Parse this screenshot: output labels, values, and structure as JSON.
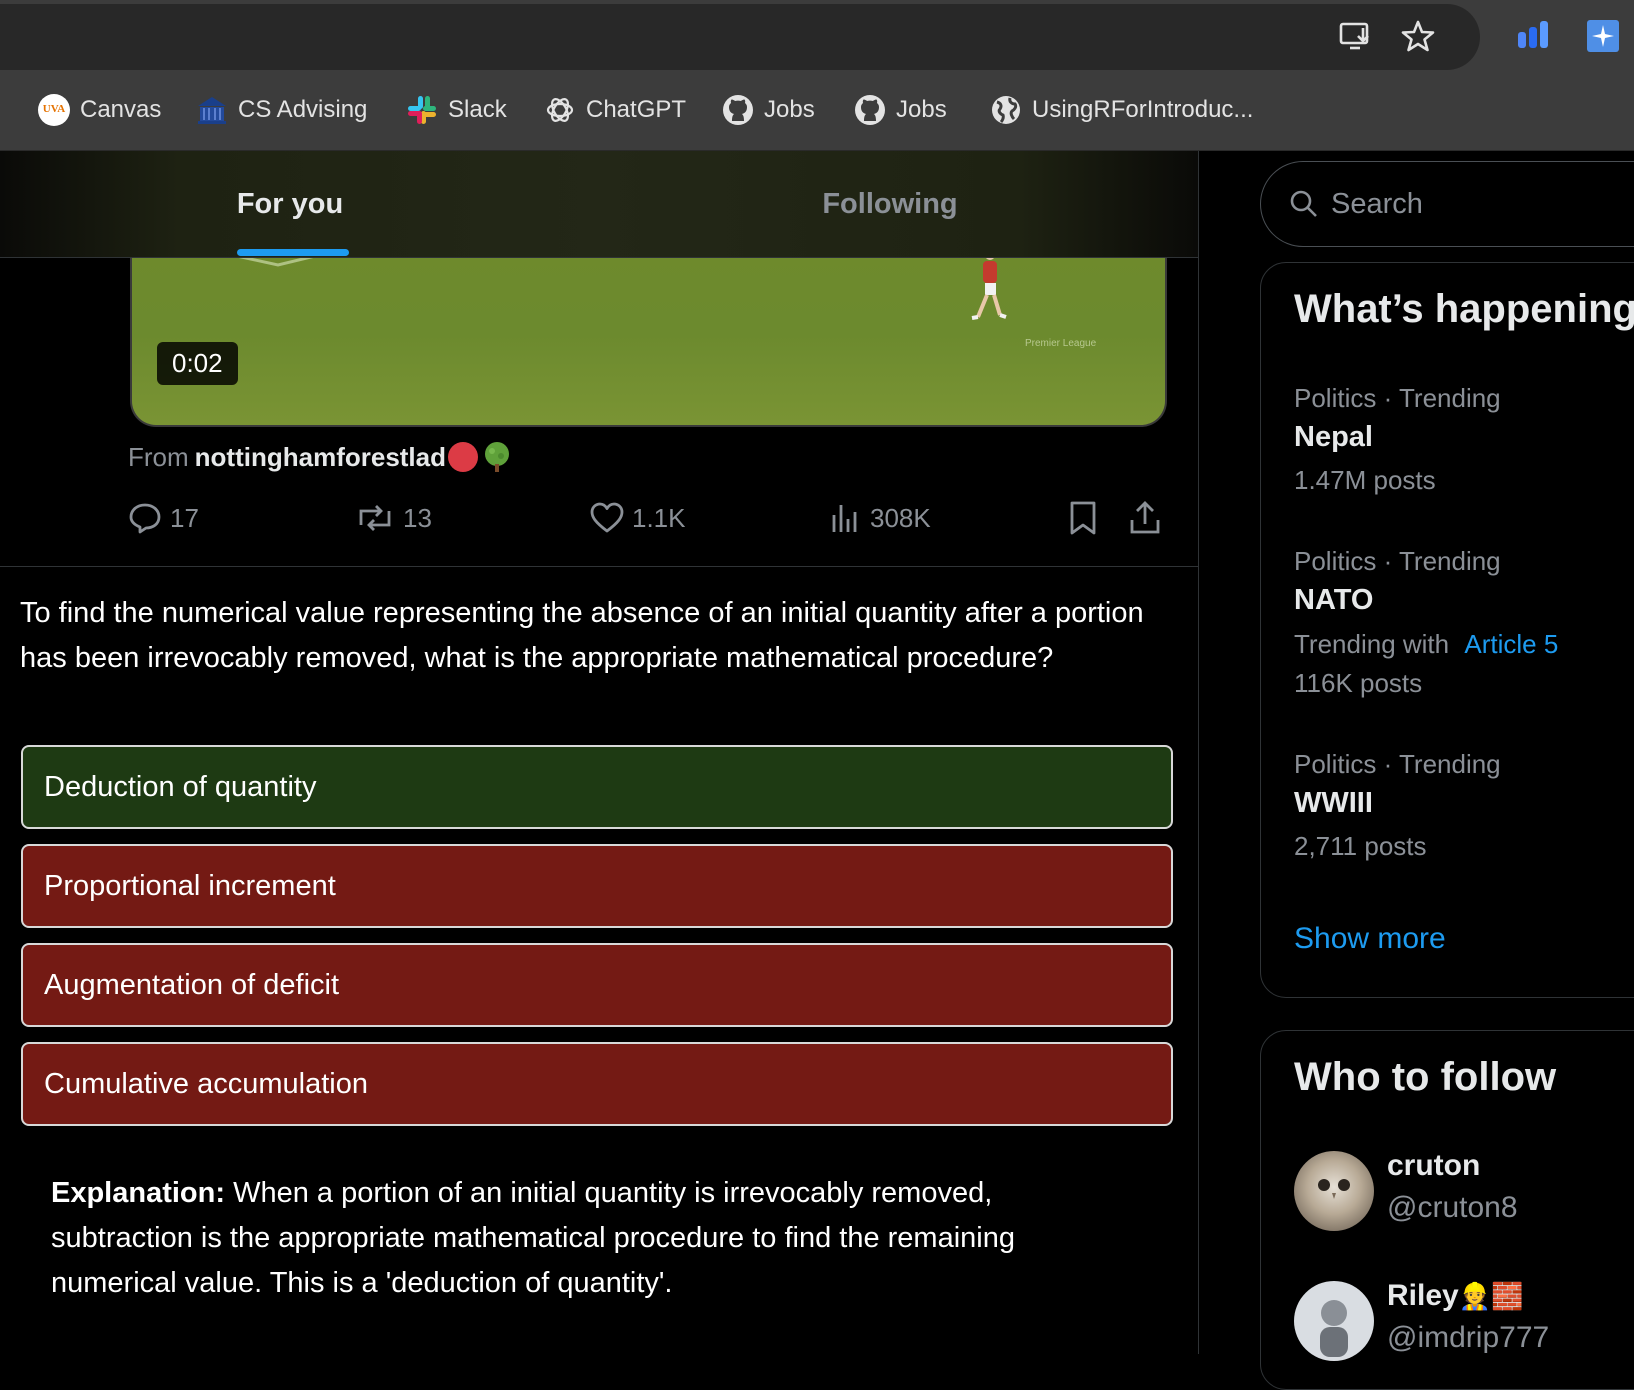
{
  "bookmarks": [
    {
      "label": "Canvas",
      "icon": "uva-icon",
      "icon_text": "UVA"
    },
    {
      "label": "CS Advising",
      "icon": "institution-icon"
    },
    {
      "label": "Slack",
      "icon": "slack-icon"
    },
    {
      "label": "ChatGPT",
      "icon": "openai-icon"
    },
    {
      "label": "Jobs",
      "icon": "github-icon"
    },
    {
      "label": "Jobs",
      "icon": "github-icon"
    },
    {
      "label": "UsingRForIntroduc...",
      "icon": "globe-icon"
    }
  ],
  "feed_tabs": {
    "for_you": "For you",
    "following": "Following"
  },
  "video": {
    "duration": "0:02",
    "watermark": "Premier League"
  },
  "post": {
    "from_label": "From",
    "author": "nottinghamforestlad",
    "actions": {
      "replies": "17",
      "reposts": "13",
      "likes": "1.1K",
      "views": "308K"
    }
  },
  "quiz": {
    "question": "To find the numerical value representing the absence of an initial quantity after a portion has been irrevocably removed, what is the appropriate mathematical procedure?",
    "options": [
      {
        "label": "Deduction of quantity",
        "state": "correct"
      },
      {
        "label": "Proportional increment",
        "state": "wrong"
      },
      {
        "label": "Augmentation of deficit",
        "state": "wrong"
      },
      {
        "label": "Cumulative accumulation",
        "state": "wrong"
      }
    ],
    "explanation_label": "Explanation:",
    "explanation_text": " When a portion of an initial quantity is irrevocably removed, subtraction is the appropriate mathematical procedure to find the remaining numerical value. This is a 'deduction of quantity'."
  },
  "sidebar": {
    "search_placeholder": "Search",
    "trends_title": "What’s happening",
    "trends": [
      {
        "meta": "Politics · Trending",
        "name": "Nepal",
        "count": "1.47M posts"
      },
      {
        "meta": "Politics · Trending",
        "name": "NATO",
        "with_label": "Trending with",
        "with_link": "Article 5",
        "count": "116K posts"
      },
      {
        "meta": "Politics · Trending",
        "name": "WWIII",
        "count": "2,711 posts"
      }
    ],
    "show_more": "Show more",
    "who_to_follow_title": "Who to follow",
    "follow": [
      {
        "name": "cruton",
        "handle": "@cruton8"
      },
      {
        "name": "Riley",
        "handle": "@imdrip777",
        "emoji": "👷🧱"
      }
    ]
  },
  "colors": {
    "accent": "#1d9bf0",
    "correct": "#1e3a13",
    "wrong": "#741a14",
    "like_dot": "#dc3b45"
  }
}
